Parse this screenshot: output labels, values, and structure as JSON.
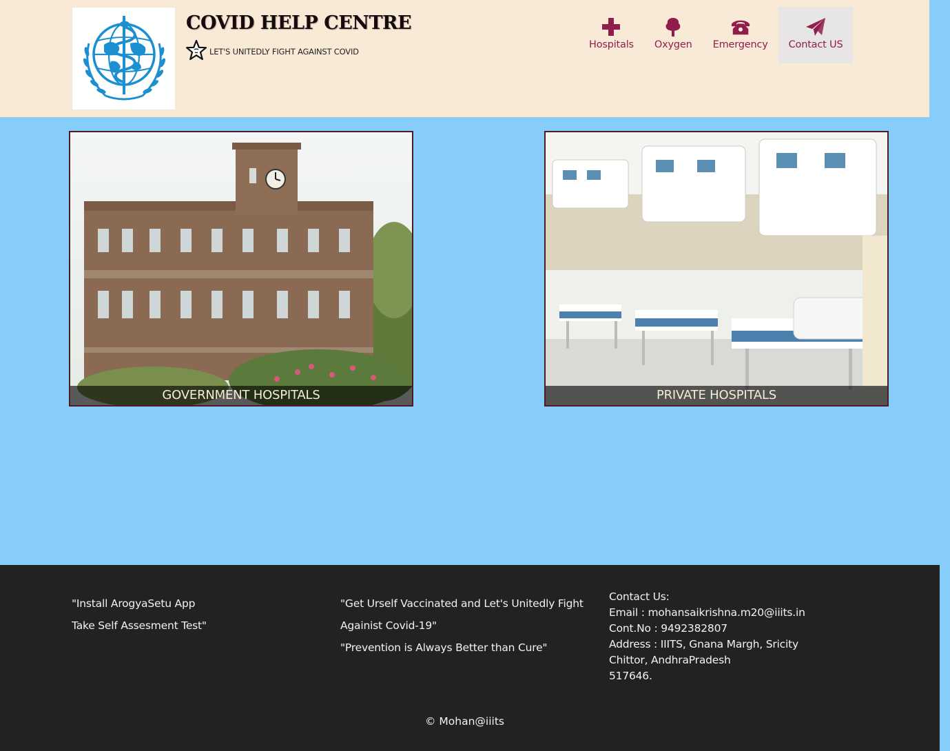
{
  "header": {
    "title": "COVID HELP CENTRE",
    "tagline": "LET'S UNITEDLY FIGHT AGAINST COVID",
    "logo_icon": "who-emblem-logo",
    "tagline_icon": "star-icon"
  },
  "nav": {
    "items": [
      {
        "label": "Hospitals",
        "icon": "plus-icon"
      },
      {
        "label": "Oxygen",
        "icon": "tree-icon"
      },
      {
        "label": "Emergency",
        "icon": "phone-icon"
      },
      {
        "label": "Contact US",
        "icon": "send-icon"
      }
    ],
    "active": "Contact US",
    "color": "#8f1e4d"
  },
  "cards": {
    "government": {
      "caption": "GOVERNMENT HOSPITALS"
    },
    "private": {
      "caption": "PRIVATE HOSPITALS"
    }
  },
  "footer": {
    "col1": {
      "line1": "\"Install ArogyaSetu App",
      "line2": "Take Self Assesment Test\""
    },
    "col2": {
      "quote1": "\"Get Urself Vaccinated and Let's Unitedly Fight Againist Covid-19\"",
      "quote2": "\"Prevention is Always Better than Cure\""
    },
    "contact": {
      "heading": "Contact Us:",
      "email": "Email : mohansaikrishna.m20@iiits.in",
      "phone": "Cont.No : 9492382807",
      "address1": "Address : IIITS, Gnana Margh, Sricity",
      "address2": "Chittor, AndhraPradesh",
      "address3": "517646."
    },
    "copyright": "© Mohan@iiits"
  },
  "colors": {
    "page_background": "#87cdf9",
    "header_background": "#f9ead7",
    "footer_background": "#222222",
    "accent": "#8f1e4d"
  }
}
